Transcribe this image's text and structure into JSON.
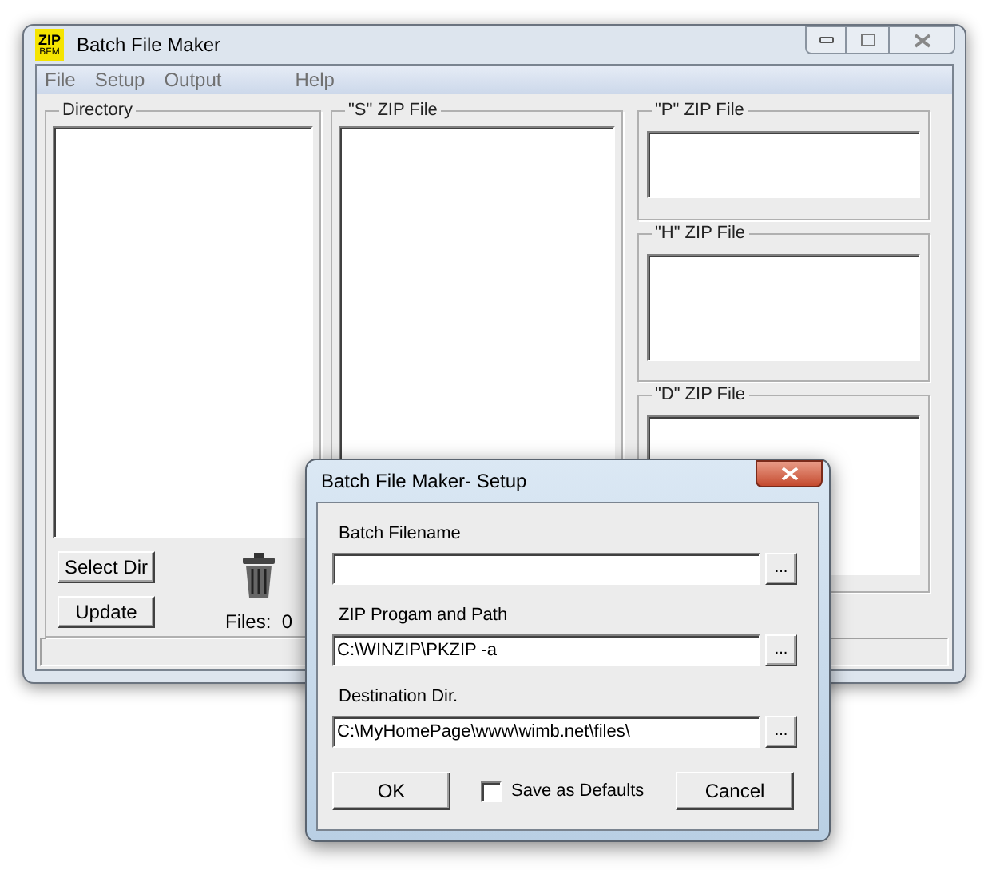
{
  "window": {
    "logo_top": "ZIP",
    "logo_bottom": "BFM",
    "title": "Batch File Maker"
  },
  "menu": [
    {
      "label": "File"
    },
    {
      "label": "Setup"
    },
    {
      "label": "Output"
    },
    {
      "label": "Help"
    }
  ],
  "directory": {
    "label": "Directory",
    "buttons": [
      "Select Dir",
      "Update"
    ],
    "files_label": "Files:",
    "files_count": "0"
  },
  "s_zip": {
    "label": "\"S\" ZIP File"
  },
  "right_groups": [
    {
      "label": "\"P\" ZIP File"
    },
    {
      "label": "\"H\" ZIP File"
    },
    {
      "label": "\"D\" ZIP File"
    }
  ],
  "dialog": {
    "title": "Batch File Maker- Setup",
    "fields": [
      {
        "label": "Batch Filename",
        "browse": "..."
      },
      {
        "label": "ZIP Progam and Path",
        "value": "C:\\WINZIP\\PKZIP -a",
        "browse": "..."
      },
      {
        "label": "Destination Dir.",
        "value": "C:\\MyHomePage\\www\\wimb.net\\files\\",
        "browse": "..."
      }
    ],
    "ok": "OK",
    "save_defaults": {
      "label": "Save as Defaults",
      "checked": false
    },
    "cancel": "Cancel"
  }
}
